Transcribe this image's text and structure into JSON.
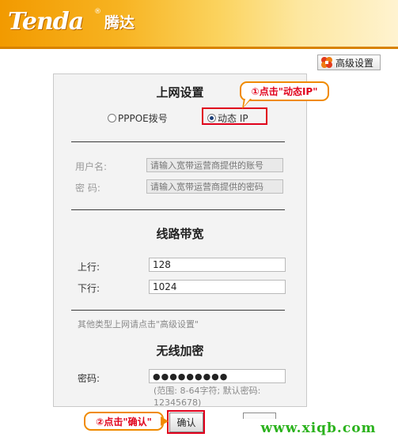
{
  "header": {
    "brand": "Tenda",
    "registered": "®",
    "brand_cn": "腾达"
  },
  "toolbar": {
    "advanced_label": "高级设置"
  },
  "internet": {
    "title": "上网设置",
    "options": [
      "PPPOE拨号",
      "动态 IP"
    ],
    "selected": "动态 IP",
    "username_label": "用户名:",
    "username_placeholder": "请输入宽带运营商提供的账号",
    "password_label": "密  码:",
    "password_placeholder": "请输入宽带运营商提供的密码"
  },
  "bandwidth": {
    "title": "线路带宽",
    "up_label": "上行:",
    "up_value": "128",
    "down_label": "下行:",
    "down_value": "1024"
  },
  "other_hint": "其他类型上网请点击\"高级设置\"",
  "wireless": {
    "title": "无线加密",
    "password_label": "密码:",
    "password_value": "●●●●●●●●●",
    "password_hint": "(范围: 8-64字符; 默认密码: 12345678)"
  },
  "callouts": {
    "step1": "①点击\"动态IP\"",
    "step2": "②点击\"确认\""
  },
  "actions": {
    "confirm_label": "确认"
  },
  "watermark": "www.xiqb.com",
  "colors": {
    "header_orange": "#f29a00",
    "highlight_red": "#e0001b",
    "callout_border": "#f08a00",
    "watermark_green": "#2bb21d"
  }
}
